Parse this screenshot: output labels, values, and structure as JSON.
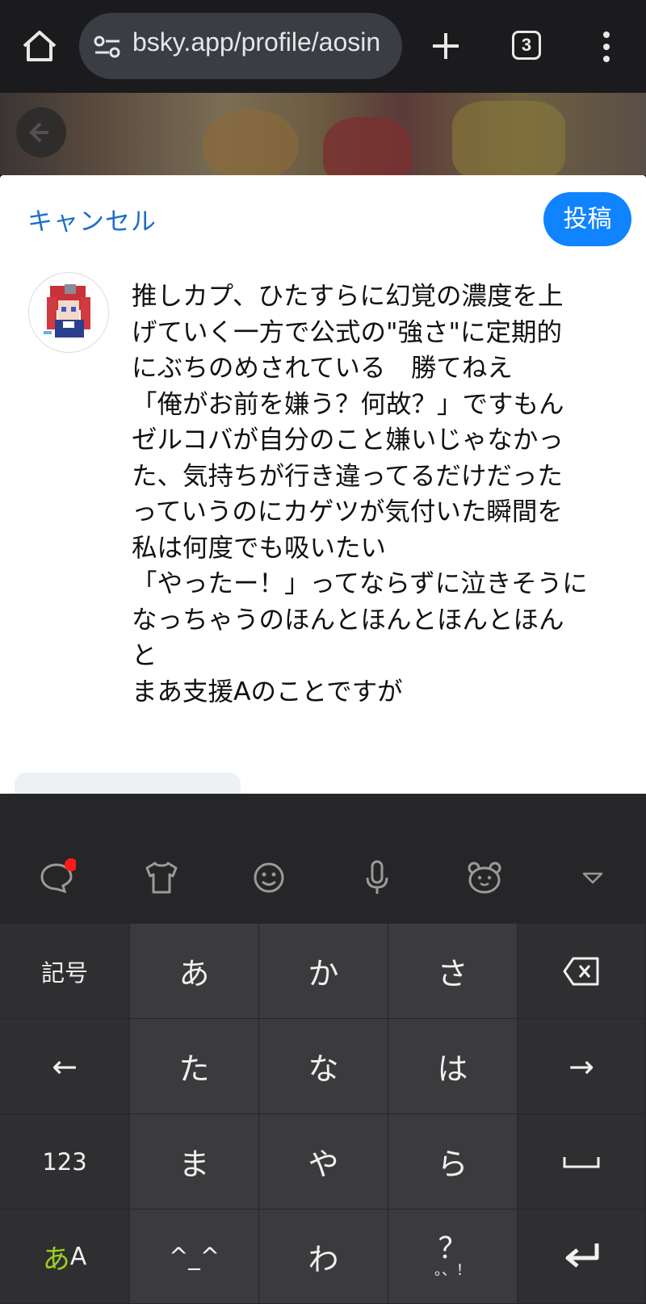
{
  "browser": {
    "url": "bsky.app/profile/aosin",
    "tab_count": "3"
  },
  "composer": {
    "cancel_label": "キャンセル",
    "post_label": "投稿",
    "post_text": "推しカプ、ひたすらに幻覚の濃度を上\nげていく一方で公式の\"強さ\"に定期的\nにぶちのめされている　勝てねえ\n「俺がお前を嫌う？何故？」ですもん\nゼルコバが自分のこと嫌いじゃなかっ\nた、気持ちが行き違ってるだけだった\nっていうのにカゲツが気付いた瞬間を\n私は何度でも吸いたい\n「やったー！」ってならずに泣きそうに\nなっちゃうのほんとほんとほんとほん\nと\nまあ支援Aのことですが"
  },
  "keyboard": {
    "toolbar_icons": [
      "chat-icon",
      "shirt-icon",
      "smiley-icon",
      "microphone-icon",
      "bear-icon",
      "collapse-icon"
    ],
    "keys": {
      "symbols": "記号",
      "a": "あ",
      "ka": "か",
      "sa": "さ",
      "left": "←",
      "ta": "た",
      "na": "な",
      "ha": "は",
      "right": "→",
      "num": "123",
      "ma": "ま",
      "ya": "や",
      "ra": "ら",
      "emoticon": "^_^",
      "wa": "わ",
      "punct": "？",
      "punct_sub": "。、！",
      "mode_kana": "あ",
      "mode_latin": "A"
    },
    "colors": {
      "mode_accent": "#9ad21e",
      "badge": "#ff1a1a"
    }
  }
}
